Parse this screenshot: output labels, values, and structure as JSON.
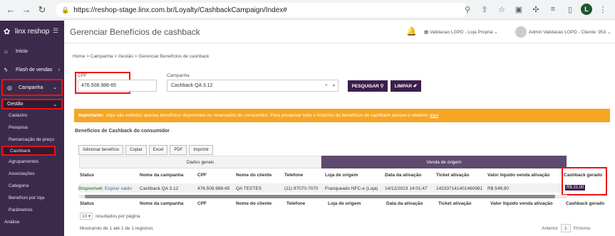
{
  "browser": {
    "url_host": "https://reshop-stage.linx.com.br",
    "url_path": "/Loyalty/CashbackCampaign/Index#",
    "profile": "L"
  },
  "sidebar": {
    "logo": "linx reshop",
    "items": [
      {
        "label": "Início",
        "icon": "home-icon"
      },
      {
        "label": "Flash de vendas",
        "icon": "flash-icon"
      },
      {
        "label": "Campanha",
        "icon": "target-icon"
      },
      {
        "label": "Gestão",
        "icon": ""
      }
    ],
    "sub_items": [
      "Cadastro",
      "Pesquisa",
      "Remarcação de preço",
      "Cashback",
      "Agrupamentos",
      "Associações",
      "Categoria",
      "Benefício por loja",
      "Parâmetros",
      "Análise"
    ]
  },
  "header": {
    "title": "Gerenciar Benefícios de cashback",
    "store": "Validacao LGPD - Loja Própria",
    "user": "Admin Validacao LGPD - Cliente: 953"
  },
  "breadcrumb": "Home > Campanha > Gestão > Gerenciar Benefícios de cashback",
  "filters": {
    "cpf_label": "CPF",
    "cpf_value": "476.508.988-65",
    "campaign_label": "Campanha",
    "campaign_value": "Cashback QA 3.12",
    "search_label": "PESQUISAR",
    "clear_label": "LIMPAR"
  },
  "banner": {
    "strong": "Importante:",
    "text": "Aqui são exibidos apenas benefícios disponíveis ou reservados do consumidor. Para pesquisar todo o histórico de benefícios de cashback acesse o relatório",
    "link": "aqui"
  },
  "section_title": "Benefícios de Cashback do consumidor",
  "tools": [
    "Adicionar benefício",
    "Copiar",
    "Excel",
    "PDF",
    "Imprimir"
  ],
  "table": {
    "group_general": "Dados gerais",
    "group_origin": "Venda de origem",
    "columns": [
      "Status",
      "Nome da campanha",
      "CPF",
      "Nome do cliente",
      "Telefone",
      "Loja de origem",
      "Data da ativação",
      "Ticket ativação",
      "Valor líquido venda ativação",
      "Cashback gerado"
    ],
    "row": {
      "status": "Disponível",
      "action": "Expirar saldo",
      "campaign": "Cashback QA 3.12",
      "cpf": "476.508.988-65",
      "client": "QA TESTES",
      "phone": "(11) 97070-7070",
      "store": "Franqueado NFC-e (Loja)",
      "date": "14/12/2023 14:01:47",
      "ticket": "142337141401460981",
      "value": "R$ 549,90",
      "cashback": "R$ 22,00"
    }
  },
  "footer": {
    "page_size": "10",
    "page_size_suffix": "resultados por página",
    "info": "Mostrando de 1 até 1 de 1 registros",
    "prev": "Anterior",
    "page": "1",
    "next": "Próximo"
  }
}
